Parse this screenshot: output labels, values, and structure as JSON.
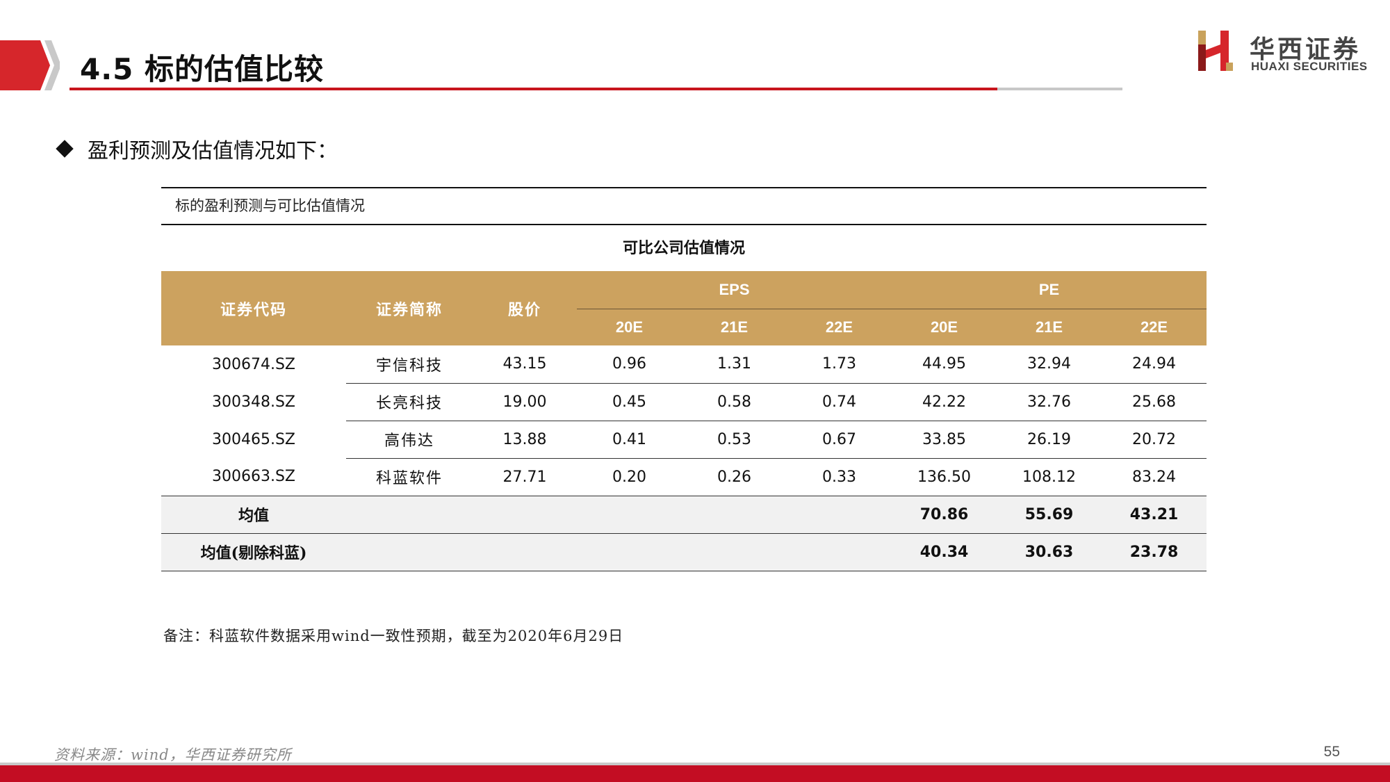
{
  "header": {
    "title": "4.5 标的估值比较",
    "logo_cn": "华西证券",
    "logo_en": "HUAXI SECURITIES"
  },
  "colors": {
    "brand_red": "#c8151d",
    "table_header": "#cca25f",
    "avg_row_bg": "#f1f1f1"
  },
  "bullet": {
    "icon": "diamond-icon",
    "text": "盈利预测及估值情况如下："
  },
  "table": {
    "caption": "标的盈利预测与可比估值情况",
    "heading": "可比公司估值情况",
    "headers": {
      "code": "证券代码",
      "name": "证券简称",
      "price": "股价",
      "eps": "EPS",
      "pe": "PE",
      "years": [
        "20E",
        "21E",
        "22E",
        "20E",
        "21E",
        "22E"
      ]
    },
    "rows": [
      {
        "code": "300674.SZ",
        "name": "宇信科技",
        "price": "43.15",
        "eps": [
          "0.96",
          "1.31",
          "1.73"
        ],
        "pe": [
          "44.95",
          "32.94",
          "24.94"
        ]
      },
      {
        "code": "300348.SZ",
        "name": "长亮科技",
        "price": "19.00",
        "eps": [
          "0.45",
          "0.58",
          "0.74"
        ],
        "pe": [
          "42.22",
          "32.76",
          "25.68"
        ]
      },
      {
        "code": "300465.SZ",
        "name": "高伟达",
        "price": "13.88",
        "eps": [
          "0.41",
          "0.53",
          "0.67"
        ],
        "pe": [
          "33.85",
          "26.19",
          "20.72"
        ]
      },
      {
        "code": "300663.SZ",
        "name": "科蓝软件",
        "price": "27.71",
        "eps": [
          "0.20",
          "0.26",
          "0.33"
        ],
        "pe": [
          "136.50",
          "108.12",
          "83.24"
        ]
      }
    ],
    "averages": [
      {
        "label": "均值",
        "pe": [
          "70.86",
          "55.69",
          "43.21"
        ]
      },
      {
        "label": "均值(剔除科蓝)",
        "pe": [
          "40.34",
          "30.63",
          "23.78"
        ]
      }
    ],
    "note": "备注：科蓝软件数据采用wind一致性预期，截至为2020年6月29日"
  },
  "footer": {
    "source": "资料来源：wind，华西证券研究所",
    "page_number": "55"
  }
}
